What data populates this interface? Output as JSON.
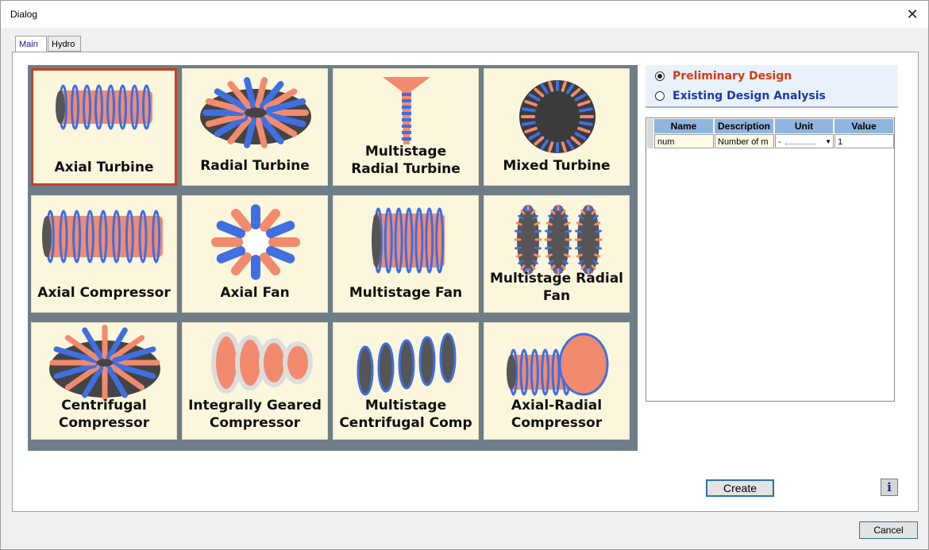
{
  "window": {
    "title": "Dialog",
    "close_glyph": "✕"
  },
  "tabs": [
    {
      "label": "Main",
      "active": true
    },
    {
      "label": "Hydro",
      "active": false
    }
  ],
  "machines": [
    {
      "label_lines": [
        "Axial Turbine"
      ],
      "selected": true
    },
    {
      "label_lines": [
        "Radial Turbine"
      ],
      "selected": false
    },
    {
      "label_lines": [
        "Multistage",
        "Radial Turbine"
      ],
      "selected": false
    },
    {
      "label_lines": [
        "Mixed  Turbine"
      ],
      "selected": false
    },
    {
      "label_lines": [
        "Axial Compressor"
      ],
      "selected": false
    },
    {
      "label_lines": [
        "Axial Fan"
      ],
      "selected": false
    },
    {
      "label_lines": [
        "Multistage Fan"
      ],
      "selected": false
    },
    {
      "label_lines": [
        "Multistage Radial",
        "Fan"
      ],
      "selected": false
    },
    {
      "label_lines": [
        "Centrifugal",
        "Compressor"
      ],
      "selected": false
    },
    {
      "label_lines": [
        "Integrally Geared",
        "Compressor"
      ],
      "selected": false
    },
    {
      "label_lines": [
        "Multistage",
        "Centrifugal Comp"
      ],
      "selected": false
    },
    {
      "label_lines": [
        "Axial-Radial",
        "Compressor"
      ],
      "selected": false
    }
  ],
  "design_mode": {
    "options": [
      {
        "label": "Preliminary Design",
        "selected": true,
        "color": "#d43a14"
      },
      {
        "label": "Existing Design Analysis",
        "selected": false,
        "color": "#1a3aa8"
      }
    ]
  },
  "params_table": {
    "columns": [
      "Name",
      "Description",
      "Unit",
      "Value"
    ],
    "rows": [
      {
        "name": "num",
        "description": "Number of m",
        "unit": "-",
        "value": "1"
      }
    ]
  },
  "buttons": {
    "create": "Create",
    "cancel": "Cancel",
    "info": "i"
  },
  "colors": {
    "grid_bg": "#6e7d88",
    "cell_bg": "#fcf6dd",
    "blade_salmon": "#f28a6e",
    "blade_blue": "#3f6fe0",
    "selected_border": "#c8401c"
  }
}
